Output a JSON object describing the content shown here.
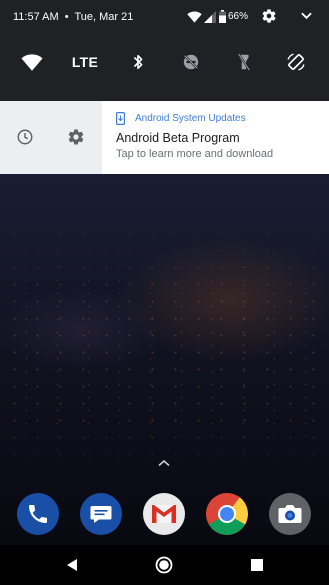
{
  "status_bar": {
    "time": "11:57 AM",
    "separator": "•",
    "date": "Tue, Mar 21",
    "battery": "66%",
    "icons": [
      "wifi-icon",
      "signal-icon",
      "battery-icon",
      "settings-gear-icon",
      "chevron-down-icon"
    ]
  },
  "quick_settings": {
    "tiles": [
      {
        "name": "wifi",
        "icon": "wifi-icon",
        "active": true
      },
      {
        "name": "mobile-data",
        "label": "LTE",
        "active": true
      },
      {
        "name": "bluetooth",
        "icon": "bluetooth-icon",
        "active": true
      },
      {
        "name": "do-not-disturb",
        "icon": "dnd-off-icon",
        "active": false
      },
      {
        "name": "flashlight",
        "icon": "flashlight-off-icon",
        "active": false
      },
      {
        "name": "auto-rotate",
        "icon": "screen-rotation-icon",
        "active": true
      }
    ]
  },
  "notification": {
    "app_name": "Android System Updates",
    "title": "Android Beta Program",
    "text": "Tap to learn more and download",
    "actions": [
      "snooze-clock-icon",
      "settings-gear-icon"
    ],
    "accent": "#3f7fd9"
  },
  "dock": {
    "apps": [
      "Phone",
      "Messages",
      "Gmail",
      "Chrome",
      "Camera"
    ]
  },
  "nav_bar": {
    "buttons": [
      "back-icon",
      "home-icon",
      "recents-icon"
    ]
  }
}
